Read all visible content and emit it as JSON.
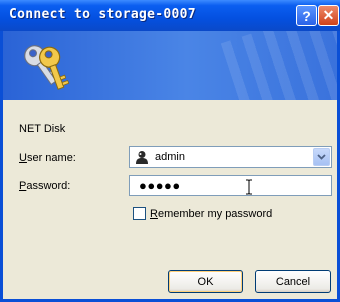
{
  "window": {
    "title": "Connect to storage-0007",
    "help_label": "?",
    "close_label": "✕"
  },
  "icons": {
    "banner": "keys-icon",
    "user": "user-icon",
    "dropdown": "chevron-down-icon",
    "cursor": "ibeam-cursor-icon"
  },
  "form": {
    "resource_name": "NET Disk",
    "username_label_accel": "U",
    "username_label_rest": "ser name:",
    "username_value": "admin",
    "password_label_accel": "P",
    "password_label_rest": "assword:",
    "password_mask": "●●●●●",
    "remember_accel": "R",
    "remember_rest": "emember my password",
    "remember_checked": false
  },
  "buttons": {
    "ok": "OK",
    "cancel": "Cancel"
  },
  "colors": {
    "titlebar": "#0a5ef0",
    "dialog_body": "#ece9d8",
    "close_button": "#d0421a"
  }
}
